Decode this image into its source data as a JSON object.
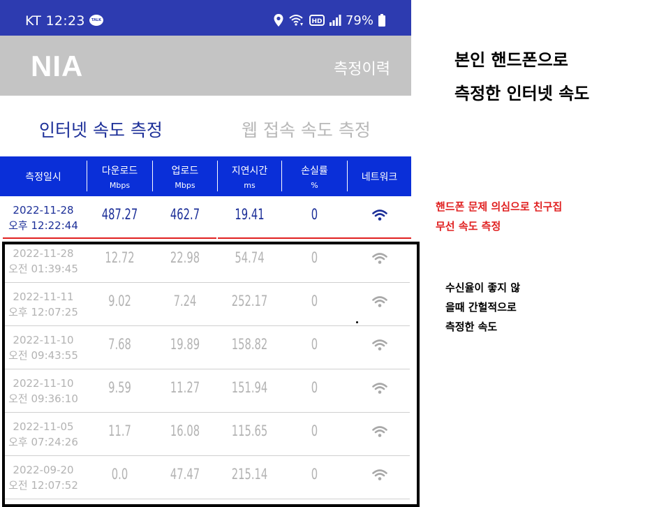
{
  "status_bar": {
    "carrier_time": "KT 12:23",
    "talk_badge": "TALK",
    "battery": "79%",
    "icons": [
      "kakaotalk-icon",
      "location-icon",
      "wifi-calling-icon",
      "hd-icon",
      "signal-icon",
      "battery-icon"
    ]
  },
  "header": {
    "logo": "NIA",
    "history_label": "측정이력"
  },
  "tabs": {
    "internet": "인터넷 속도 측정",
    "web": "웹 접속 속도 측정"
  },
  "table": {
    "columns": [
      {
        "label": "측정일시",
        "sub": ""
      },
      {
        "label": "다운로드",
        "sub": "Mbps"
      },
      {
        "label": "업로드",
        "sub": "Mbps"
      },
      {
        "label": "지연시간",
        "sub": "ms"
      },
      {
        "label": "손실률",
        "sub": "%"
      },
      {
        "label": "네트워크",
        "sub": ""
      }
    ],
    "rows": [
      {
        "date": "2022-11-28",
        "time": "오후 12:22:44",
        "down": "487.27",
        "up": "462.7",
        "latency": "19.41",
        "loss": "0",
        "network": "wifi-icon"
      },
      {
        "date": "2022-11-28",
        "time": "오전 01:39:45",
        "down": "12.72",
        "up": "22.98",
        "latency": "54.74",
        "loss": "0",
        "network": "wifi-icon"
      },
      {
        "date": "2022-11-11",
        "time": "오후 12:07:25",
        "down": "9.02",
        "up": "7.24",
        "latency": "252.17",
        "loss": "0",
        "network": "wifi-icon"
      },
      {
        "date": "2022-11-10",
        "time": "오전 09:43:55",
        "down": "7.68",
        "up": "19.89",
        "latency": "158.82",
        "loss": "0",
        "network": "wifi-icon"
      },
      {
        "date": "2022-11-10",
        "time": "오전 09:36:10",
        "down": "9.59",
        "up": "11.27",
        "latency": "151.94",
        "loss": "0",
        "network": "wifi-icon"
      },
      {
        "date": "2022-11-05",
        "time": "오후 07:24:26",
        "down": "11.7",
        "up": "16.08",
        "latency": "115.65",
        "loss": "0",
        "network": "wifi-icon"
      },
      {
        "date": "2022-09-20",
        "time": "오전 12:07:52",
        "down": "0.0",
        "up": "47.47",
        "latency": "215.14",
        "loss": "0",
        "network": "wifi-icon"
      }
    ]
  },
  "annotations": {
    "main_line1": "본인 핸드폰으로",
    "main_line2": "측정한 인터넷 속도",
    "red_line1": "핸드폰 문제 의심으로 친구집",
    "red_line2": "무선 속도 측정",
    "black_line1": "수신율이 좋지 않",
    "black_line2": "을때 간헐적으로",
    "black_line3": "측정한 속도"
  },
  "colors": {
    "status_bar": "#2d3bb0",
    "table_header": "#0a2fd8",
    "active_tab": "#1c2f98",
    "annotation_red": "#e02020",
    "header_gray": "#c4c4c4"
  }
}
